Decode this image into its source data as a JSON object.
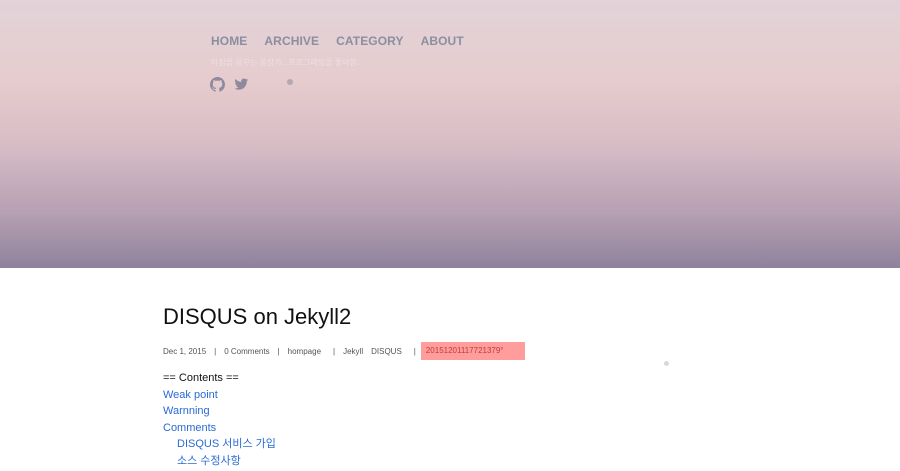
{
  "nav": {
    "items": [
      "HOME",
      "ARCHIVE",
      "CATEGORY",
      "ABOUT"
    ],
    "tagline": "아침을 꿈꾸는 몽상가...프로그래밍을 좋아함.."
  },
  "social": {
    "icons": [
      "github-icon",
      "twitter-icon"
    ]
  },
  "post": {
    "title": "DISQUS on Jekyll2",
    "meta": {
      "date": "Dec 1, 2015",
      "comments": "0 Comments",
      "category": "hompage",
      "tag1": "Jekyll",
      "tag2": "DISQUS",
      "id": "20151201117721379°"
    },
    "toc": {
      "heading": "== Contents ==",
      "items": [
        "Weak point",
        "Warnning",
        "Comments"
      ],
      "subitems": [
        "DISQUS 서비스 가입",
        "소스 수정사항"
      ]
    }
  },
  "colors": {
    "link": "#2a6ad6",
    "nav": "#8a8f9f",
    "highlight": "#ff9d9d"
  }
}
